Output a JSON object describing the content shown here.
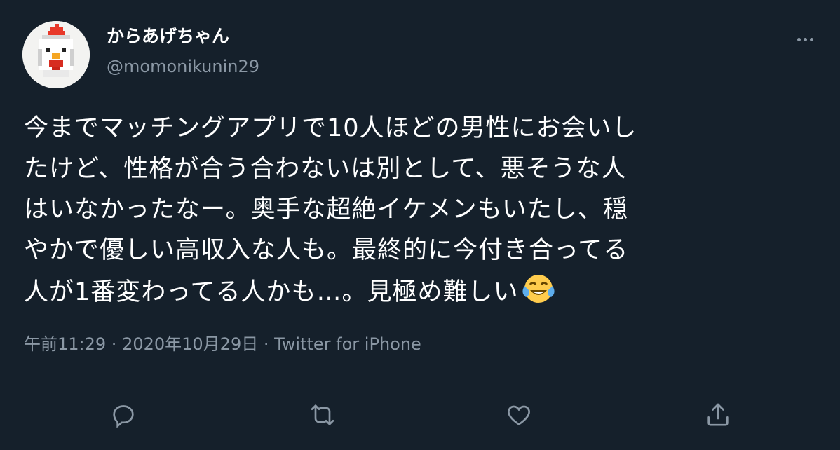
{
  "tweet": {
    "display_name": "からあげちゃん",
    "handle": "@momonikunin29",
    "text": "今までマッチングアプリで10人ほどの男性にお会いし\nたけど、性格が合う合わないは別として、悪そうな人\nはいなかったなー。奥手な超絶イケメンもいたし、穏\nやかで優しい高収入な人も。最終的に今付き合ってる\n人が1番変わってる人かも…。見極め難しい",
    "emoji": "face-with-tears-of-joy",
    "time": "午前11:29",
    "separator1": " · ",
    "date": "2020年10月29日",
    "separator2": " · ",
    "source": "Twitter for iPhone"
  },
  "icons": {
    "avatar": "pixel-chicken-avatar",
    "more": "more-options-icon",
    "reply": "reply-icon",
    "retweet": "retweet-icon",
    "like": "like-icon",
    "share": "share-icon"
  },
  "colors": {
    "background": "#15202b",
    "text_primary": "#ffffff",
    "text_secondary": "#8b98a5",
    "divider": "#38444d"
  }
}
